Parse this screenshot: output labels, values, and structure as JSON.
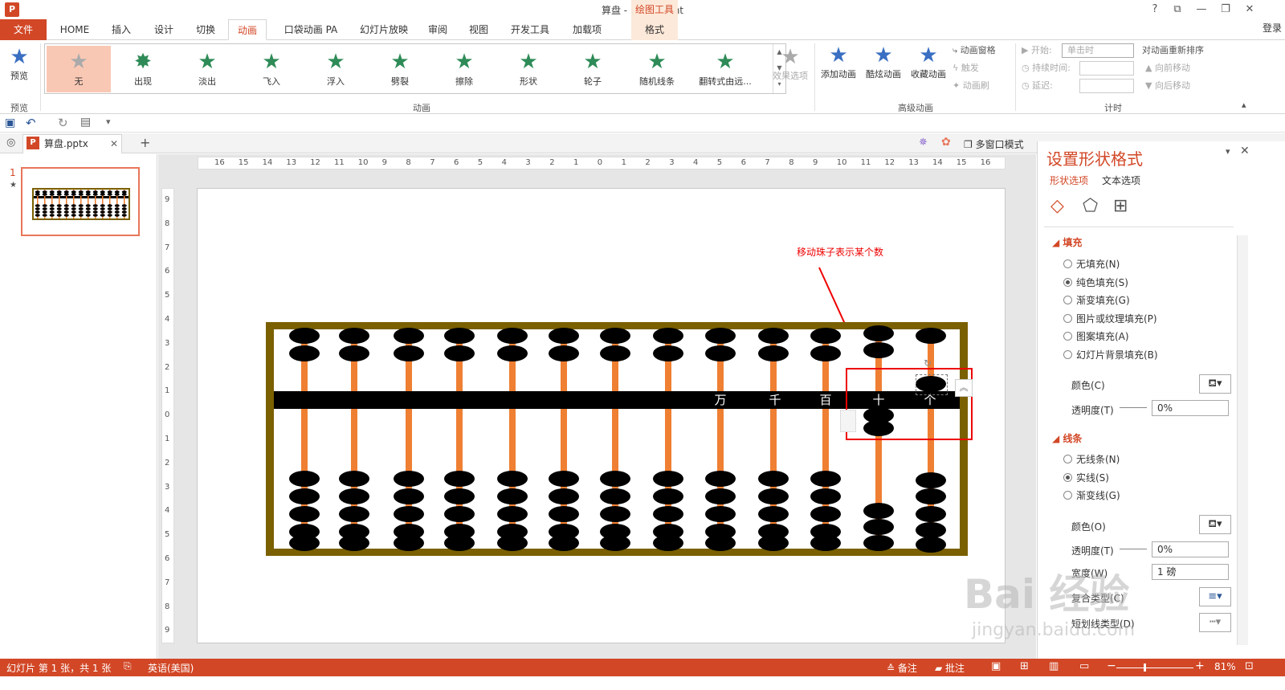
{
  "window": {
    "title": "算盘 - PowerPoint",
    "contextual_group": "绘图工具",
    "help": "?",
    "ribbon_display": "⧉",
    "minimize": "—",
    "restore": "❐",
    "close": "✕"
  },
  "tabs": {
    "file": "文件",
    "items": [
      "HOME",
      "插入",
      "设计",
      "切换",
      "动画",
      "口袋动画 PA",
      "幻灯片放映",
      "审阅",
      "视图",
      "开发工具",
      "加载项",
      "格式"
    ],
    "active": "动画",
    "login": "登录"
  },
  "ribbon": {
    "preview": {
      "label": "预览",
      "group": "预览"
    },
    "animations": [
      "无",
      "出现",
      "淡出",
      "飞入",
      "浮入",
      "劈裂",
      "擦除",
      "形状",
      "轮子",
      "随机线条",
      "翻转式由远..."
    ],
    "effect_options": "效果选项",
    "group_animation": "动画",
    "add_animation": "添加动画",
    "cool_animation": "酷炫动画",
    "fav_animation": "收藏动画",
    "anim_pane": "动画窗格",
    "trigger": "触发",
    "anim_painter": "动画刷",
    "group_advanced": "高级动画",
    "start_label": "开始:",
    "start_value": "单击时",
    "duration_label": "持续时间:",
    "delay_label": "延迟:",
    "reorder": "对动画重新排序",
    "move_earlier": "向前移动",
    "move_later": "向后移动",
    "group_timing": "计时"
  },
  "doc": {
    "tab_name": "算盘.pptx",
    "multiwindow": "多窗口模式",
    "slide_number": "1"
  },
  "ruler": {
    "h_ticks": [
      "16",
      "15",
      "14",
      "13",
      "12",
      "11",
      "10",
      "9",
      "8",
      "7",
      "6",
      "5",
      "4",
      "3",
      "2",
      "1",
      "0",
      "1",
      "2",
      "3",
      "4",
      "5",
      "6",
      "7",
      "8",
      "9",
      "10",
      "11",
      "12",
      "13",
      "14",
      "15",
      "16"
    ],
    "v_ticks": [
      "9",
      "8",
      "7",
      "6",
      "5",
      "4",
      "3",
      "2",
      "1",
      "0",
      "1",
      "2",
      "3",
      "4",
      "5",
      "6",
      "7",
      "8",
      "9"
    ]
  },
  "slide": {
    "annotation": "移动珠子表示某个数",
    "place_labels": [
      "万",
      "千",
      "百",
      "十",
      "个"
    ]
  },
  "format_panel": {
    "title": "设置形状格式",
    "tab_shape": "形状选项",
    "tab_text": "文本选项",
    "fill_section": "填充",
    "fill_options": [
      "无填充(N)",
      "纯色填充(S)",
      "渐变填充(G)",
      "图片或纹理填充(P)",
      "图案填充(A)",
      "幻灯片背景填充(B)"
    ],
    "fill_selected": 1,
    "color_label": "颜色(C)",
    "transparency_label": "透明度(T)",
    "transparency_value": "0%",
    "line_section": "线条",
    "line_options": [
      "无线条(N)",
      "实线(S)",
      "渐变线(G)"
    ],
    "line_selected": 1,
    "line_color_label": "颜色(O)",
    "line_transparency_label": "透明度(T)",
    "line_transparency_value": "0%",
    "width_label": "宽度(W)",
    "width_value": "1 磅",
    "compound_label": "复合类型(C)",
    "dash_label": "短划线类型(D)"
  },
  "status": {
    "slide_info": "幻灯片 第 1 张，共 1 张",
    "language": "英语(美国)",
    "notes": "备注",
    "comments": "批注",
    "zoom": "81%"
  },
  "watermark": {
    "brand": "Bai 经验",
    "url": "jingyan.baidu.com"
  }
}
